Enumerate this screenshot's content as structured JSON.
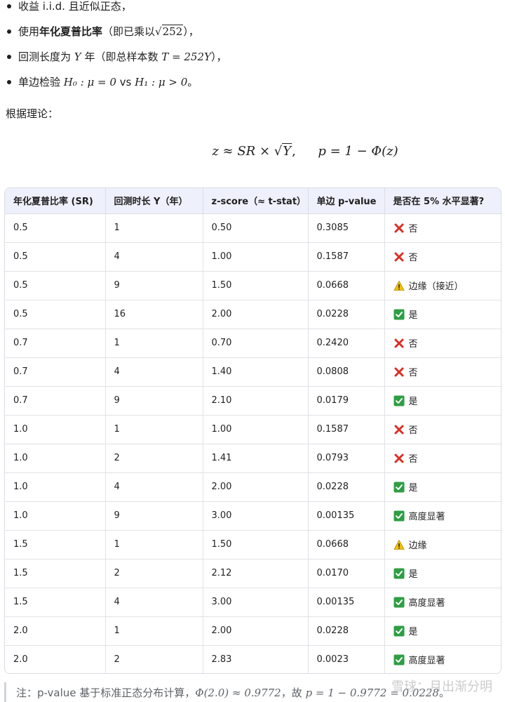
{
  "bullets": {
    "b0": "收益 i.i.d. 且近似正态，",
    "b1_pre": "使用",
    "b1_bold": "年化夏普比率",
    "b1_post": "（即已乘以",
    "b1_sqrt": "252",
    "b1_end": "），",
    "b2_pre": "回测长度为",
    "b2_var": "Y",
    "b2_mid": "年（即总样本数",
    "b2_math": "T = 252Y",
    "b2_end": "），",
    "b3_pre": "单边检验",
    "b3_h0": "H₀ : μ = 0",
    "b3_vs": "vs",
    "b3_h1": "H₁ : μ > 0",
    "b3_end": "。"
  },
  "intro": "根据理论：",
  "formula": {
    "lhs": "z ≈ SR ×",
    "sqrt_arg": "Y",
    "comma": ",",
    "rhs": "p = 1 − Φ(z)"
  },
  "table": {
    "headers": [
      "年化夏普比率 (SR)",
      "回测时长 Y（年）",
      "z-score（≈ t-stat）",
      "单边 p-value",
      "是否在 5% 水平显著?"
    ],
    "rows": [
      {
        "sr": "0.5",
        "y": "1",
        "z": "0.50",
        "p": "0.3085",
        "icon": "cross-icon",
        "sig": "否"
      },
      {
        "sr": "0.5",
        "y": "4",
        "z": "1.00",
        "p": "0.1587",
        "icon": "cross-icon",
        "sig": "否"
      },
      {
        "sr": "0.5",
        "y": "9",
        "z": "1.50",
        "p": "0.0668",
        "icon": "warning-icon",
        "sig": "边缘（接近）"
      },
      {
        "sr": "0.5",
        "y": "16",
        "z": "2.00",
        "p": "0.0228",
        "icon": "check-icon",
        "sig": "是"
      },
      {
        "sr": "0.7",
        "y": "1",
        "z": "0.70",
        "p": "0.2420",
        "icon": "cross-icon",
        "sig": "否"
      },
      {
        "sr": "0.7",
        "y": "4",
        "z": "1.40",
        "p": "0.0808",
        "icon": "cross-icon",
        "sig": "否"
      },
      {
        "sr": "0.7",
        "y": "9",
        "z": "2.10",
        "p": "0.0179",
        "icon": "check-icon",
        "sig": "是"
      },
      {
        "sr": "1.0",
        "y": "1",
        "z": "1.00",
        "p": "0.1587",
        "icon": "cross-icon",
        "sig": "否"
      },
      {
        "sr": "1.0",
        "y": "2",
        "z": "1.41",
        "p": "0.0793",
        "icon": "cross-icon",
        "sig": "否"
      },
      {
        "sr": "1.0",
        "y": "4",
        "z": "2.00",
        "p": "0.0228",
        "icon": "check-icon",
        "sig": "是"
      },
      {
        "sr": "1.0",
        "y": "9",
        "z": "3.00",
        "p": "0.00135",
        "icon": "check-icon",
        "sig": "高度显著"
      },
      {
        "sr": "1.5",
        "y": "1",
        "z": "1.50",
        "p": "0.0668",
        "icon": "warning-icon",
        "sig": "边缘"
      },
      {
        "sr": "1.5",
        "y": "2",
        "z": "2.12",
        "p": "0.0170",
        "icon": "check-icon",
        "sig": "是"
      },
      {
        "sr": "1.5",
        "y": "4",
        "z": "3.00",
        "p": "0.00135",
        "icon": "check-icon",
        "sig": "高度显著"
      },
      {
        "sr": "2.0",
        "y": "1",
        "z": "2.00",
        "p": "0.0228",
        "icon": "check-icon",
        "sig": "是"
      },
      {
        "sr": "2.0",
        "y": "2",
        "z": "2.83",
        "p": "0.0023",
        "icon": "check-icon",
        "sig": "高度显著"
      }
    ]
  },
  "note": {
    "text": "注：p-value 基于标准正态分布计算，",
    "math1": "Φ(2.0) ≈ 0.9772",
    "mid": "，故",
    "math2": "p = 1 − 0.9772 = 0.0228",
    "end": "。"
  },
  "watermark": "雪球：月出渐分明",
  "colors": {
    "header_bg": "#eef0fb",
    "border": "#d9dde3",
    "cross": "#d93025",
    "check": "#2e9e44",
    "warning": "#f2c200"
  }
}
